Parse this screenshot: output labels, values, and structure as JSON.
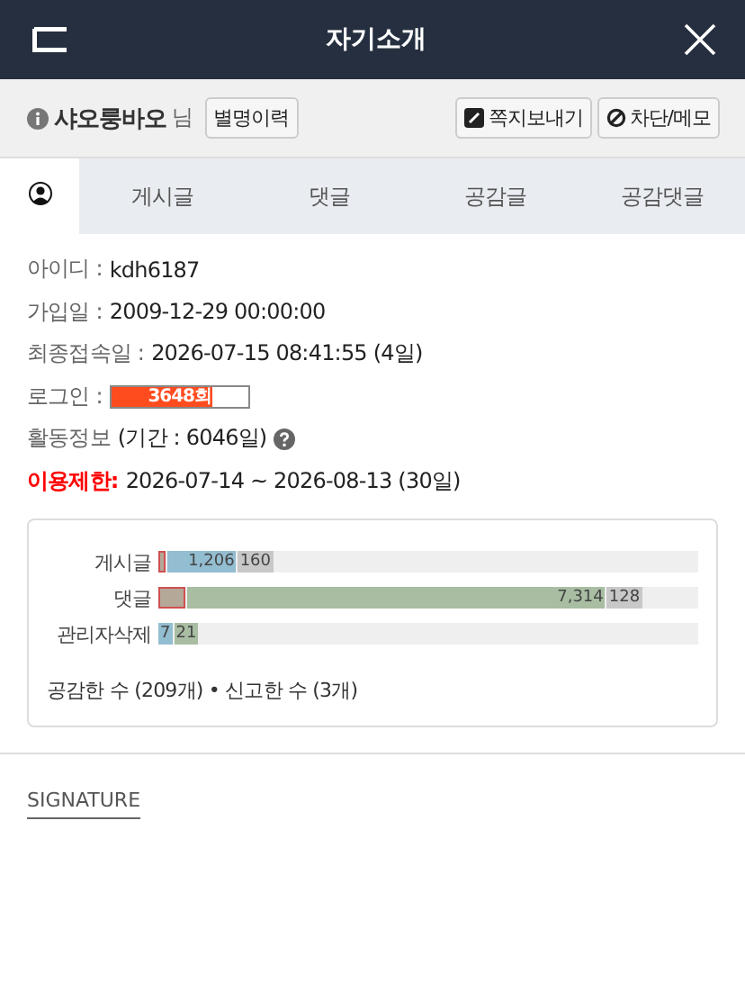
{
  "header": {
    "title": "자기소개"
  },
  "profile": {
    "nickname": "샤오룽바오",
    "suffix": "님",
    "history_button": "별명이력",
    "actions": [
      {
        "kind": "message",
        "label": "쪽지보내기"
      },
      {
        "kind": "block",
        "label": "차단/메모"
      }
    ]
  },
  "tabs": [
    {
      "kind": "profile",
      "selected": true
    },
    {
      "label": "게시글",
      "selected": false
    },
    {
      "label": "댓글",
      "selected": false
    },
    {
      "label": "공감글",
      "selected": false
    },
    {
      "label": "공감댓글",
      "selected": false
    }
  ],
  "info": [
    {
      "kind": "text",
      "label": "아이디 :",
      "value": "kdh6187"
    },
    {
      "kind": "text",
      "label": "가입일 :",
      "value": "2009-12-29 00:00:00"
    },
    {
      "kind": "text",
      "label": "최종접속일 :",
      "value": "2026-07-15 08:41:55 (4일)"
    },
    {
      "kind": "meter",
      "label": "로그인 :",
      "value": "3648회",
      "level": 0.74
    },
    {
      "kind": "help",
      "label": "활동정보",
      "value": "(기간 : 6046일)"
    },
    {
      "kind": "alert",
      "label": "이용제한:",
      "value": "2026-07-14 ~ 2026-08-13 (30일)"
    }
  ],
  "activity": {
    "rows": [
      {
        "label": "게시글",
        "segments": [
          {
            "kind": "deleted"
          },
          {
            "kind": "post",
            "value": "1,206"
          },
          {
            "kind": "other",
            "value": "160"
          }
        ]
      },
      {
        "label": "댓글",
        "segments": [
          {
            "kind": "deleted"
          },
          {
            "kind": "comment",
            "value": "7,314"
          },
          {
            "kind": "other",
            "value": "128"
          }
        ]
      },
      {
        "label": "관리자삭제",
        "segments": [
          {
            "kind": "post",
            "value": "7"
          },
          {
            "kind": "comment",
            "value": "21"
          }
        ]
      }
    ],
    "summary": "공감한 수 (209개) • 신고한 수 (3개)"
  },
  "signature": {
    "label": "SIGNATURE"
  }
}
